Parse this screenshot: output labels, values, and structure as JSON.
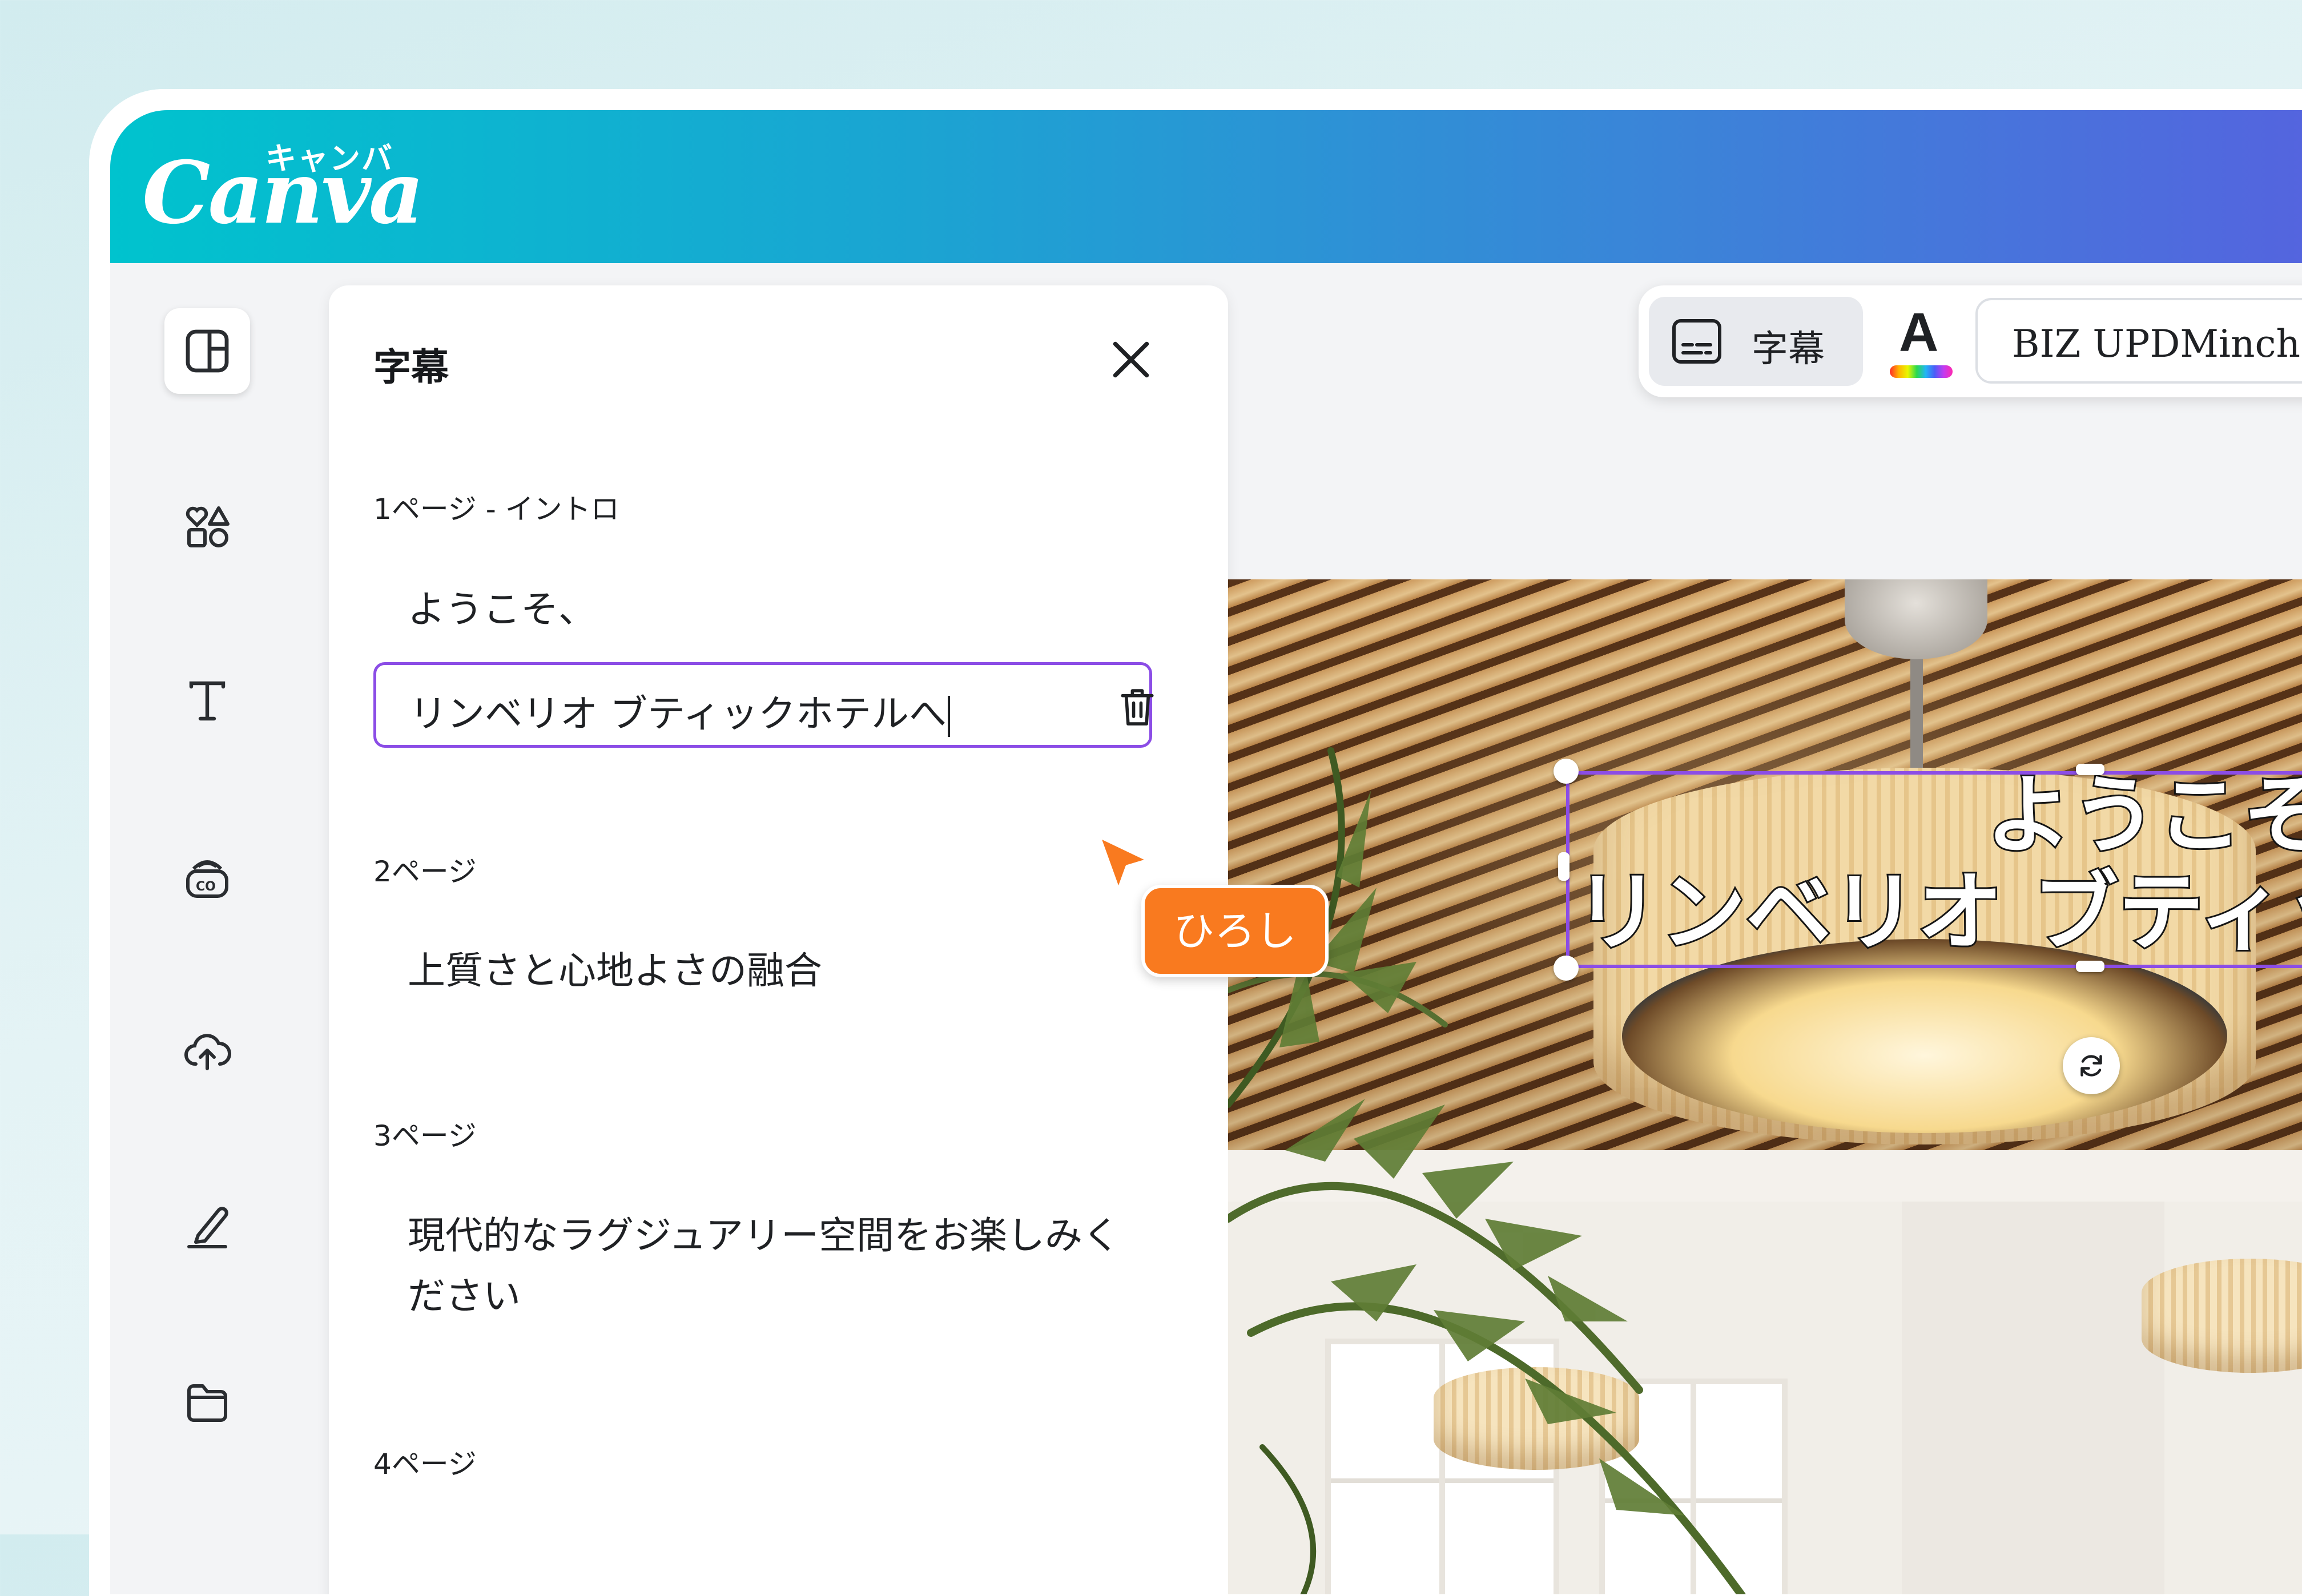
{
  "app": {
    "logo_word": "Canva",
    "logo_kana": "キャンバ"
  },
  "rail": {
    "items": [
      {
        "icon": "layout-icon",
        "active": true
      },
      {
        "icon": "elements-icon"
      },
      {
        "icon": "text-icon"
      },
      {
        "icon": "brand-icon"
      },
      {
        "icon": "upload-cloud-icon"
      },
      {
        "icon": "draw-icon"
      },
      {
        "icon": "folder-icon"
      }
    ]
  },
  "panel": {
    "title": "字幕",
    "pages": [
      {
        "label": "1ページ - イントロ",
        "lines": [
          "ようこそ、"
        ],
        "editing_value": "リンベリオ ブティックホテルへ"
      },
      {
        "label": "2ページ",
        "lines": [
          "上質さと心地よさの融合"
        ]
      },
      {
        "label": "3ページ",
        "lines": [
          "現代的なラグジュアリー空間をお楽しみください"
        ]
      },
      {
        "label": "4ページ",
        "lines": []
      }
    ],
    "collaborator": "ひろし"
  },
  "toolbar": {
    "caption_label": "字幕",
    "color_letter": "A",
    "font_name": "BIZ UPDMincho"
  },
  "canvas": {
    "subtitle_line1": "ようこそ、",
    "subtitle_line2": "リンベリオ ブティックホテルへ"
  },
  "colors": {
    "accent": "#8b4de6",
    "collaborator": "#f97a1f",
    "header_start": "#00c3ce",
    "header_end": "#5563df"
  }
}
